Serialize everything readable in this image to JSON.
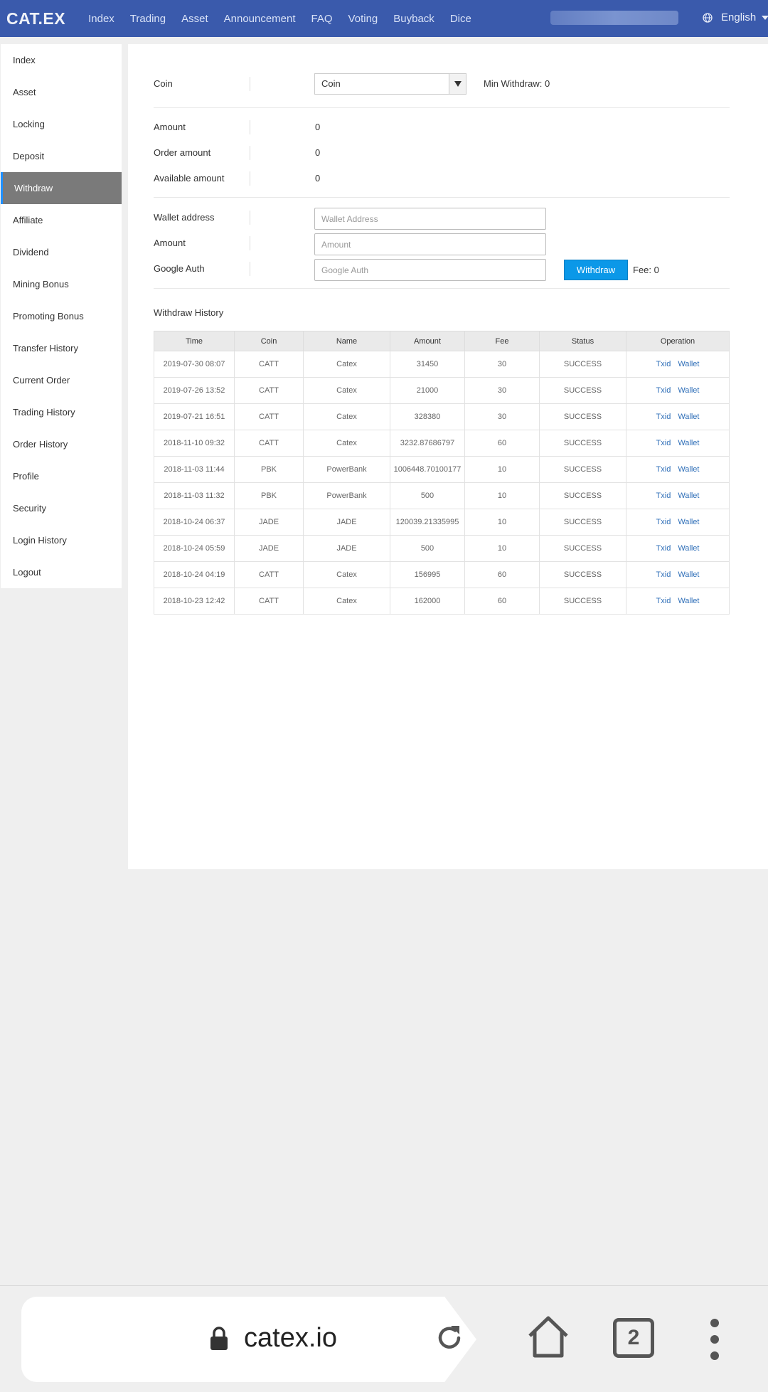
{
  "header": {
    "logo": "CAT.EX",
    "nav": [
      "Index",
      "Trading",
      "Asset",
      "Announcement",
      "FAQ",
      "Voting",
      "Buyback",
      "Dice"
    ],
    "language": "English"
  },
  "sidebar": {
    "items": [
      "Index",
      "Asset",
      "Locking",
      "Deposit",
      "Withdraw",
      "Affiliate",
      "Dividend",
      "Mining Bonus",
      "Promoting Bonus",
      "Transfer History",
      "Current Order",
      "Trading History",
      "Order History",
      "Profile",
      "Security",
      "Login History",
      "Logout"
    ],
    "active": "Withdraw"
  },
  "form": {
    "coin_label": "Coin",
    "coin_value": "Coin",
    "min_withdraw": "Min Withdraw: 0",
    "amount_label": "Amount",
    "amount_value": "0",
    "order_amount_label": "Order amount",
    "order_amount_value": "0",
    "available_label": "Available amount",
    "available_value": "0",
    "wallet_label": "Wallet address",
    "wallet_placeholder": "Wallet Address",
    "amount_input_label": "Amount",
    "amount_placeholder": "Amount",
    "google_label": "Google Auth",
    "google_placeholder": "Google Auth",
    "withdraw_button": "Withdraw",
    "fee": "Fee: 0"
  },
  "history": {
    "title": "Withdraw History",
    "columns": [
      "Time",
      "Coin",
      "Name",
      "Amount",
      "Fee",
      "Status",
      "Operation"
    ],
    "rows": [
      [
        "2019-07-30 08:07",
        "CATT",
        "Catex",
        "31450",
        "30",
        "SUCCESS"
      ],
      [
        "2019-07-26 13:52",
        "CATT",
        "Catex",
        "21000",
        "30",
        "SUCCESS"
      ],
      [
        "2019-07-21 16:51",
        "CATT",
        "Catex",
        "328380",
        "30",
        "SUCCESS"
      ],
      [
        "2018-11-10 09:32",
        "CATT",
        "Catex",
        "3232.87686797",
        "60",
        "SUCCESS"
      ],
      [
        "2018-11-03 11:44",
        "PBK",
        "PowerBank",
        "1006448.70100177",
        "10",
        "SUCCESS"
      ],
      [
        "2018-11-03 11:32",
        "PBK",
        "PowerBank",
        "500",
        "10",
        "SUCCESS"
      ],
      [
        "2018-10-24 06:37",
        "JADE",
        "JADE",
        "120039.21335995",
        "10",
        "SUCCESS"
      ],
      [
        "2018-10-24 05:59",
        "JADE",
        "JADE",
        "500",
        "10",
        "SUCCESS"
      ],
      [
        "2018-10-24 04:19",
        "CATT",
        "Catex",
        "156995",
        "60",
        "SUCCESS"
      ],
      [
        "2018-10-23 12:42",
        "CATT",
        "Catex",
        "162000",
        "60",
        "SUCCESS"
      ]
    ],
    "op_txid": "Txid",
    "op_wallet": "Wallet"
  },
  "browser": {
    "url": "catex.io",
    "tab_count": "2"
  },
  "colors": {
    "nav_bg": "#3a5aac",
    "active_sidebar": "#7a7a7a",
    "button": "#0b98e8",
    "link": "#2f6fb8"
  }
}
